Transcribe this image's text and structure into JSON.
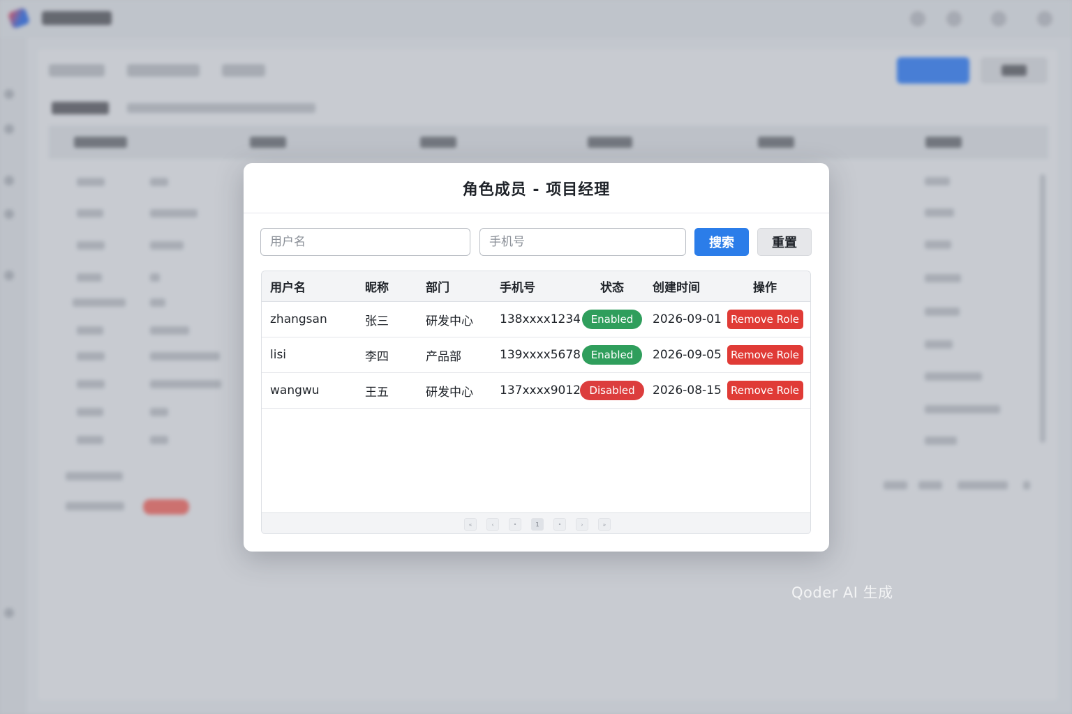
{
  "background_app": {
    "accent_color": "#3d7ee6"
  },
  "modal": {
    "title": "角色成员 - 项目经理",
    "filters": {
      "username_placeholder": "用户名",
      "phone_placeholder": "手机号",
      "search_label": "搜索",
      "reset_label": "重置"
    },
    "table": {
      "headers": [
        "用户名",
        "昵称",
        "部门",
        "手机号",
        "状态",
        "创建时间",
        "操作"
      ],
      "rows": [
        {
          "username": "zhangsan",
          "nickname": "张三",
          "department": "研发中心",
          "phone": "138xxxx1234",
          "status": "Enabled",
          "status_color": "#2f9e5c",
          "created": "2026-09-01",
          "action": "Remove Role"
        },
        {
          "username": "lisi",
          "nickname": "李四",
          "department": "产品部",
          "phone": "139xxxx5678",
          "status": "Enabled",
          "status_color": "#2f9e5c",
          "created": "2026-09-05",
          "action": "Remove Role"
        },
        {
          "username": "wangwu",
          "nickname": "王五",
          "department": "研发中心",
          "phone": "137xxxx9012",
          "status": "Disabled",
          "status_color": "#dc3d3d",
          "created": "2026-08-15",
          "action": "Remove Role"
        }
      ]
    },
    "pagination": {
      "buttons": [
        "«",
        "‹",
        "•",
        "1",
        "•",
        "›",
        "»"
      ],
      "active_index": 3
    }
  },
  "watermark": "Qoder AI 生成"
}
